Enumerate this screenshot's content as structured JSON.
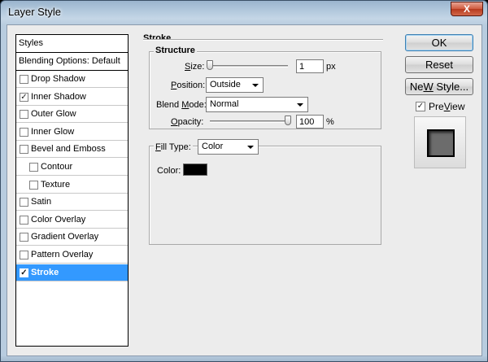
{
  "window": {
    "title": "Layer Style",
    "close_glyph": "X"
  },
  "styles_panel": {
    "header": "Styles",
    "blending_label": "Blending Options: Default",
    "items": [
      {
        "label": "Drop Shadow",
        "checked": false,
        "indent": false,
        "selected": false
      },
      {
        "label": "Inner Shadow",
        "checked": true,
        "indent": false,
        "selected": false
      },
      {
        "label": "Outer Glow",
        "checked": false,
        "indent": false,
        "selected": false
      },
      {
        "label": "Inner Glow",
        "checked": false,
        "indent": false,
        "selected": false
      },
      {
        "label": "Bevel and Emboss",
        "checked": false,
        "indent": false,
        "selected": false
      },
      {
        "label": "Contour",
        "checked": false,
        "indent": true,
        "selected": false
      },
      {
        "label": "Texture",
        "checked": false,
        "indent": true,
        "selected": false
      },
      {
        "label": "Satin",
        "checked": false,
        "indent": false,
        "selected": false
      },
      {
        "label": "Color Overlay",
        "checked": false,
        "indent": false,
        "selected": false
      },
      {
        "label": "Gradient Overlay",
        "checked": false,
        "indent": false,
        "selected": false
      },
      {
        "label": "Pattern Overlay",
        "checked": false,
        "indent": false,
        "selected": false
      },
      {
        "label": "Stroke",
        "checked": true,
        "indent": false,
        "selected": true
      }
    ]
  },
  "stroke": {
    "section_title": "Stroke",
    "structure_title": "Structure",
    "size": {
      "label_accel": "S",
      "label_rest": "ize:",
      "value": "1",
      "unit": "px",
      "slider_min": 1,
      "slider_max": 250
    },
    "position": {
      "label_accel": "P",
      "label_rest": "osition:",
      "value": "Outside"
    },
    "blend_mode": {
      "label_pre": "Blend ",
      "label_accel": "M",
      "label_rest": "ode:",
      "value": "Normal"
    },
    "opacity": {
      "label_accel": "O",
      "label_rest": "pacity:",
      "value": "100",
      "unit": "%",
      "fraction": 1.0
    },
    "fill_type": {
      "label_accel": "F",
      "label_rest": "ill Type:",
      "value": "Color"
    },
    "color": {
      "label": "Color:",
      "swatch": "#000000"
    }
  },
  "buttons": {
    "ok": "OK",
    "reset": "Reset",
    "new_style": {
      "accel": "W",
      "pre": "Ne",
      "rest": " Style..."
    },
    "preview": {
      "label_accel": "V",
      "label_pre": "Pre",
      "label_rest": "iew",
      "checked": true
    }
  },
  "colors": {
    "selection": "#3399ff",
    "dialog_bg": "#ececec"
  }
}
